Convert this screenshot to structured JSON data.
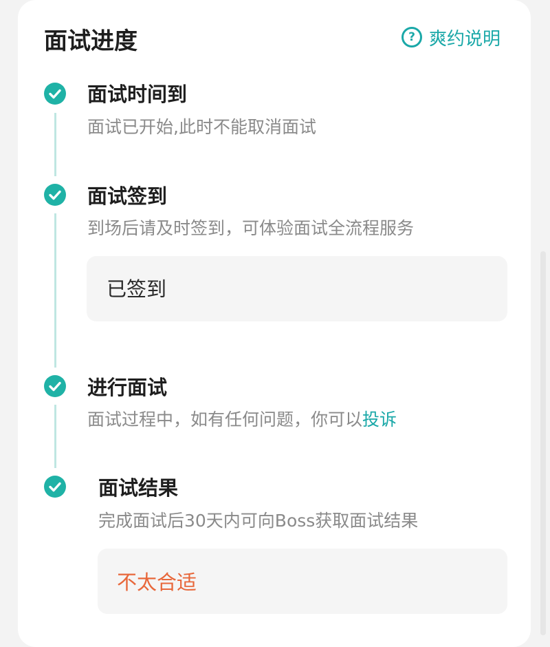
{
  "header": {
    "title": "面试进度",
    "help_label": "爽约说明",
    "help_icon": "question-circle-icon"
  },
  "colors": {
    "accent": "#1fb2a6",
    "link": "#1aa8a8",
    "result_negative": "#e8673a"
  },
  "steps": [
    {
      "title": "面试时间到",
      "desc": "面试已开始,此时不能取消面试",
      "icon": "check-circle-icon"
    },
    {
      "title": "面试签到",
      "desc": "到场后请及时签到，可体验面试全流程服务",
      "status": "已签到",
      "icon": "check-circle-icon"
    },
    {
      "title": "进行面试",
      "desc_prefix": "面试过程中，如有任何问题，你可以",
      "desc_link": "投诉",
      "icon": "check-circle-icon"
    },
    {
      "title": "面试结果",
      "desc": "完成面试后30天内可向Boss获取面试结果",
      "status": "不太合适",
      "icon": "check-circle-icon"
    }
  ]
}
